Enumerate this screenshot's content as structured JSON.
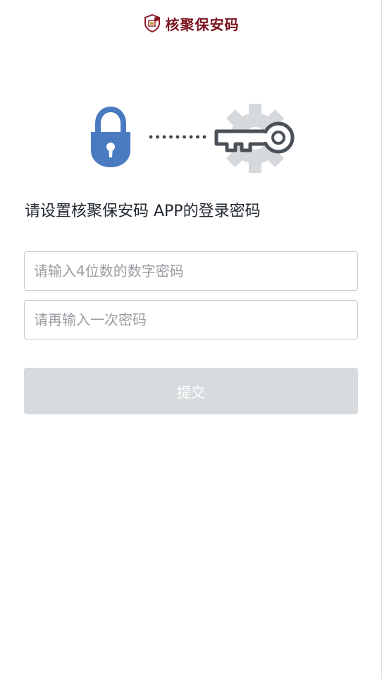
{
  "header": {
    "brand": "核聚保安码"
  },
  "hero": {
    "lock_icon": "lock-icon",
    "dots_icon": "dots-icon",
    "key_icon": "key-gear-icon",
    "lock_color": "#4a7ac0",
    "key_color": "#4a5158",
    "gear_color": "#d6d9dc"
  },
  "form": {
    "prompt": "请设置核聚保安码 APP的登录密码",
    "password_placeholder": "请输入4位数的数字密码",
    "confirm_placeholder": "请再输入一次密码",
    "submit_label": "提交"
  }
}
